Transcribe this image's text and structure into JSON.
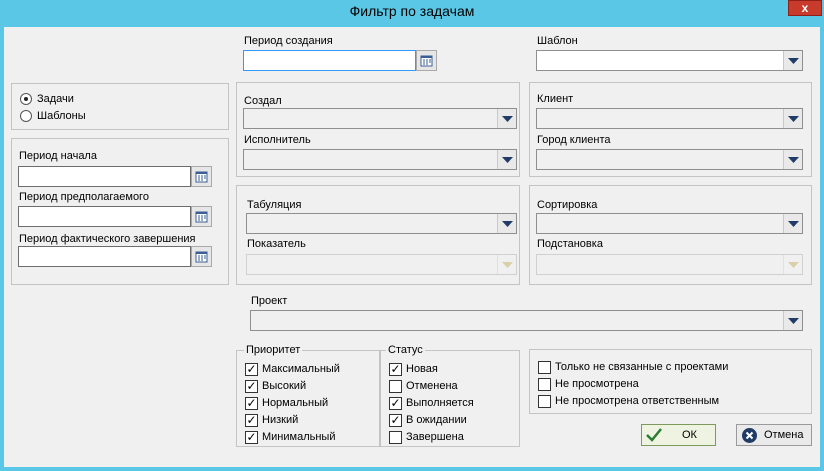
{
  "window": {
    "title": "Фильтр по задачам",
    "close": "x"
  },
  "type_group": {
    "tasks": "Задачи",
    "templates": "Шаблоны",
    "selected": "tasks"
  },
  "periods": {
    "creation": "Период создания",
    "start": "Период начала",
    "expected": "Период предполагаемого",
    "actual_end": "Период фактического завершения"
  },
  "people": {
    "created_by": "Создал",
    "executor": "Исполнитель"
  },
  "template": {
    "label": "Шаблон"
  },
  "client": {
    "label": "Клиент",
    "city": "Город клиента"
  },
  "tabulation": {
    "label": "Табуляция",
    "indicator": "Показатель"
  },
  "sorting": {
    "label": "Сортировка",
    "substitution": "Подстановка"
  },
  "project": {
    "label": "Проект"
  },
  "priority": {
    "legend": "Приоритет",
    "items": [
      {
        "label": "Максимальный",
        "checked": true
      },
      {
        "label": "Высокий",
        "checked": true
      },
      {
        "label": "Нормальный",
        "checked": true
      },
      {
        "label": "Низкий",
        "checked": true
      },
      {
        "label": "Минимальный",
        "checked": true
      }
    ]
  },
  "status": {
    "legend": "Статус",
    "items": [
      {
        "label": "Новая",
        "checked": true
      },
      {
        "label": "Отменена",
        "checked": false
      },
      {
        "label": "Выполняется",
        "checked": true
      },
      {
        "label": "В ожидании",
        "checked": true
      },
      {
        "label": "Завершена",
        "checked": false
      }
    ]
  },
  "options": {
    "items": [
      {
        "label": "Только не связанные с проектами",
        "checked": false
      },
      {
        "label": "Не просмотрена",
        "checked": false
      },
      {
        "label": "Не просмотрена ответственным",
        "checked": false
      }
    ]
  },
  "buttons": {
    "ok": "ОК",
    "cancel": "Отмена"
  },
  "colors": {
    "titlebar": "#5bc7e6",
    "close": "#c73a2c",
    "focus_border": "#3399ff",
    "ok_icon": "#2e7d32",
    "cancel_icon": "#1f3b66"
  }
}
